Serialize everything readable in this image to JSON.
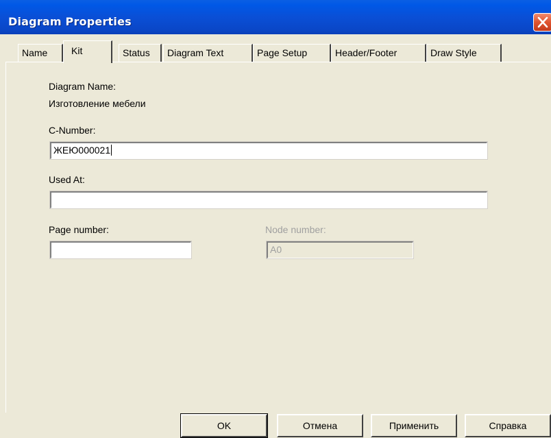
{
  "window": {
    "title": "Diagram Properties"
  },
  "tabs": [
    {
      "label": "Name"
    },
    {
      "label": "Kit"
    },
    {
      "label": "Status"
    },
    {
      "label": "Diagram Text"
    },
    {
      "label": "Page Setup"
    },
    {
      "label": "Header/Footer"
    },
    {
      "label": "Draw Style"
    }
  ],
  "active_tab": "Kit",
  "form": {
    "diagram_name_label": "Diagram Name:",
    "diagram_name_value": "Изготовление мебели",
    "c_number_label": "C-Number:",
    "c_number_value": "ЖЕЮ000021",
    "used_at_label": "Used At:",
    "used_at_value": "",
    "page_number_label": "Page number:",
    "page_number_value": "",
    "node_number_label": "Node number:",
    "node_number_value": "A0"
  },
  "buttons": {
    "ok": "OK",
    "cancel": "Отмена",
    "apply": "Применить",
    "help": "Справка"
  },
  "colors": {
    "titlebar": "#0a4fd6",
    "dialog_bg": "#ece9d8",
    "close_button": "#e0542f"
  }
}
